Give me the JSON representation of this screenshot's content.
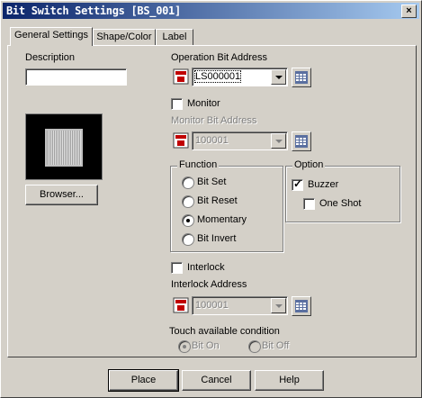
{
  "window": {
    "title": "Bit Switch Settings [BS_001]",
    "close_glyph": "×"
  },
  "tabs": [
    {
      "label": "General Settings",
      "active": true
    },
    {
      "label": "Shape/Color",
      "active": false
    },
    {
      "label": "Label",
      "active": false
    }
  ],
  "description": {
    "label": "Description",
    "value": ""
  },
  "preview": {
    "browser_label": "Browser..."
  },
  "operation": {
    "label": "Operation Bit Address",
    "value": "LS000001",
    "icon": "address-input-icon",
    "grid_icon": "keypad-icon"
  },
  "monitor": {
    "label": "Monitor",
    "checked": false
  },
  "monitor_address": {
    "label": "Monitor Bit Address",
    "value": "100001",
    "enabled": false
  },
  "function": {
    "title": "Function",
    "options": [
      {
        "label": "Bit Set",
        "selected": false
      },
      {
        "label": "Bit Reset",
        "selected": false
      },
      {
        "label": "Momentary",
        "selected": true
      },
      {
        "label": "Bit Invert",
        "selected": false
      }
    ]
  },
  "option": {
    "title": "Option",
    "buzzer": {
      "label": "Buzzer",
      "checked": true
    },
    "one_shot": {
      "label": "One Shot",
      "checked": false
    }
  },
  "interlock": {
    "label": "Interlock",
    "checked": false
  },
  "interlock_address": {
    "label": "Interlock Address",
    "value": "100001",
    "enabled": false
  },
  "touch": {
    "label": "Touch available condition",
    "options": [
      {
        "label": "Bit On",
        "selected": true
      },
      {
        "label": "Bit Off",
        "selected": false
      }
    ]
  },
  "footer": {
    "place": "Place",
    "cancel": "Cancel",
    "help": "Help"
  }
}
